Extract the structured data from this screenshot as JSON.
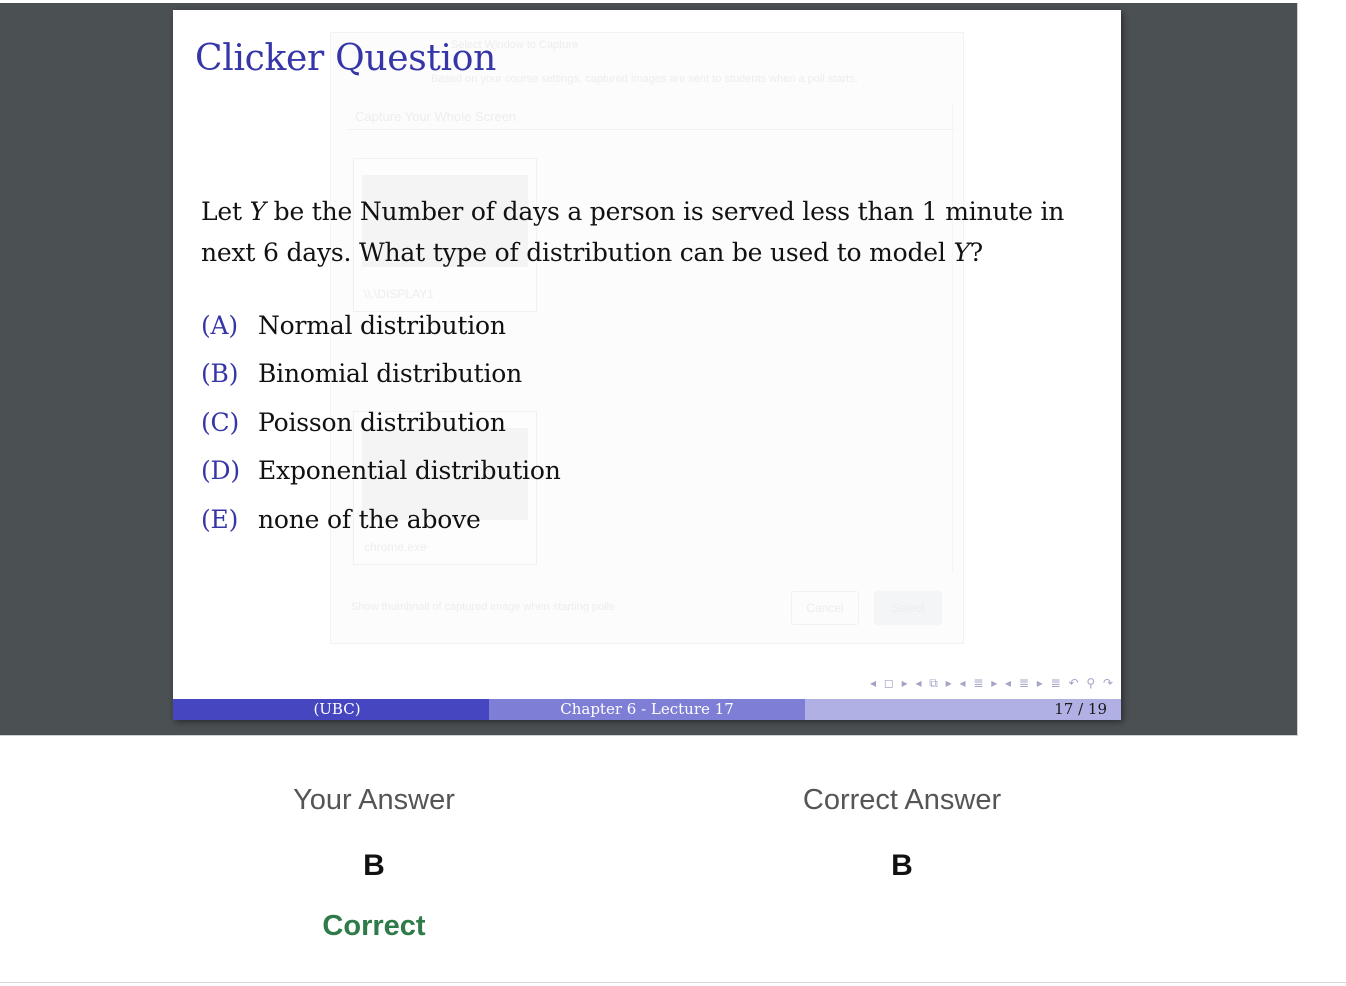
{
  "ghost_dialog": {
    "title": "Select Window to Capture",
    "info": "Based on your course settings, captured images are sent to students when a poll starts.",
    "section": "Capture Your Whole Screen",
    "thumb1_label": "\\\\.\\DISPLAY1",
    "thumb2_label": "chrome.exe",
    "checkbox": "Show thumbnail of captured image when starting polls",
    "cancel": "Cancel",
    "select": "Select"
  },
  "slide": {
    "title": "Clicker Question",
    "question": {
      "part1": "Let ",
      "var1": "Y",
      "part2": " be the Number of days a person is served less than 1 minute in next 6 days. What type of distribution can be used to model ",
      "var2": "Y",
      "part3": "?"
    },
    "choices": [
      {
        "label": "(A)",
        "text": "Normal distribution"
      },
      {
        "label": "(B)",
        "text": "Binomial distribution"
      },
      {
        "label": "(C)",
        "text": "Poisson distribution"
      },
      {
        "label": "(D)",
        "text": "Exponential distribution"
      },
      {
        "label": "(E)",
        "text": "none of the above"
      }
    ],
    "nav_symbols": "◂ ◻ ▸ ◂ ⧉ ▸ ◂ ≣ ▸ ◂ ≣ ▸ ≣ ↶ ⚲ ↷",
    "footer": {
      "left": "(UBC)",
      "middle": "Chapter 6 - Lecture 17",
      "right": "17 / 19"
    }
  },
  "results": {
    "your_answer_label": "Your Answer",
    "your_answer": "B",
    "correct_answer_label": "Correct Answer",
    "correct_answer": "B",
    "status": "Correct"
  },
  "colors": {
    "title_blue": "#3636a8",
    "status_green": "#2f7a49",
    "viewer_bg": "#4b5053"
  }
}
